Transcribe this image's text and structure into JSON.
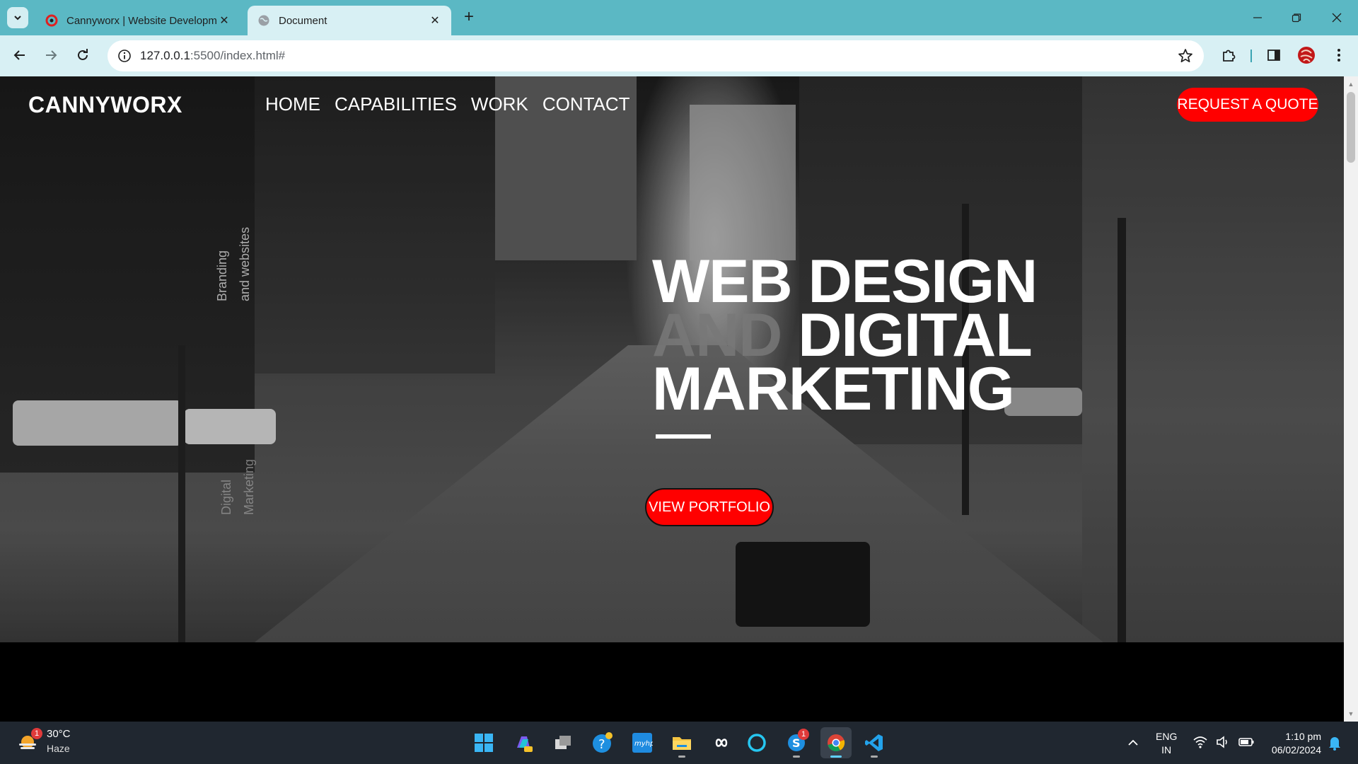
{
  "browser": {
    "tabs": [
      {
        "title": "Cannyworx | Website Developm",
        "active": false
      },
      {
        "title": "Document",
        "active": true
      }
    ],
    "url_host": "127.0.0.1",
    "url_path": ":5500/index.html#"
  },
  "site": {
    "logo": "CANNYWORX",
    "nav": [
      "HOME",
      "CAPABILITIES",
      "WORK",
      "CONTACT"
    ],
    "quote_button": "REQUEST A QUOTE",
    "vertical_text_1": "Branding\nand websites",
    "vertical_text_2": "Digital\nMarketing",
    "headline_line1": "WEB DESIGN",
    "headline_line2_dim": "AND",
    "headline_line2": " DIGITAL",
    "headline_line3": "MARKETING",
    "portfolio_button": "VIEW PORTFOLIO"
  },
  "taskbar": {
    "weather_temp": "30°C",
    "weather_cond": "Haze",
    "weather_badge": "1",
    "skype_badge": "1",
    "lang_line1": "ENG",
    "lang_line2": "IN",
    "time": "1:10 pm",
    "date": "06/02/2024"
  },
  "colors": {
    "accent": "#ff0000",
    "tabbar": "#5bb8c4",
    "toolbar": "#d8f0f4"
  }
}
